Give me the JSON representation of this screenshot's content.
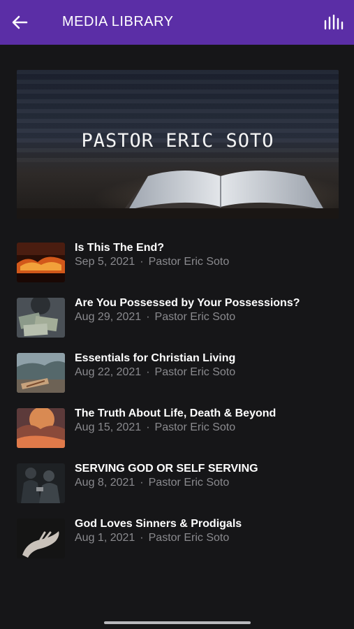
{
  "appbar": {
    "title": "MEDIA LIBRARY",
    "back_icon": "arrow-left-icon",
    "action_icon": "equalizer-icon",
    "background": "#5b2ea6"
  },
  "banner": {
    "title": "PASTOR ERIC SOTO"
  },
  "sermons": [
    {
      "title": "Is This The End?",
      "date": "Sep 5, 2021",
      "speaker": "Pastor Eric Soto",
      "separator": "·"
    },
    {
      "title": "Are You Possessed by Your Possessions?",
      "date": "Aug 29, 2021",
      "speaker": "Pastor Eric Soto",
      "separator": "·"
    },
    {
      "title": "Essentials for Christian Living",
      "date": "Aug 22, 2021",
      "speaker": "Pastor Eric Soto",
      "separator": "·"
    },
    {
      "title": "The Truth About Life, Death & Beyond",
      "date": "Aug 15, 2021",
      "speaker": "Pastor Eric Soto",
      "separator": "·"
    },
    {
      "title": "SERVING GOD OR SELF SERVING",
      "date": "Aug 8, 2021",
      "speaker": "Pastor Eric Soto",
      "separator": "·"
    },
    {
      "title": "God Loves Sinners & Prodigals",
      "date": "Aug 1, 2021",
      "speaker": "Pastor Eric Soto",
      "separator": "·"
    }
  ]
}
